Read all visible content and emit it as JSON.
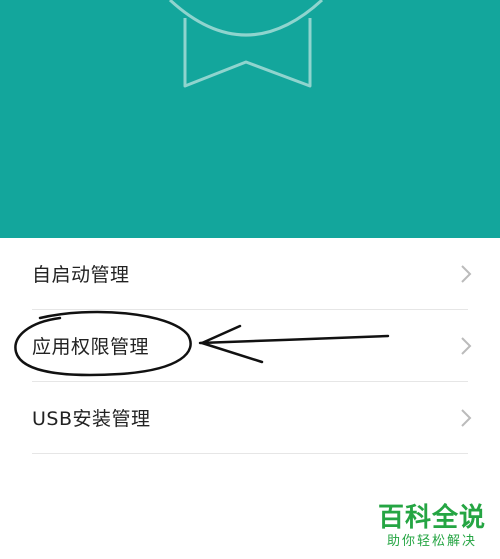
{
  "header": {
    "background_color": "#13a69c",
    "badge_icon": "ribbon-badge-icon"
  },
  "menu": {
    "items": [
      {
        "label": "自启动管理",
        "icon": "chevron-right-icon"
      },
      {
        "label": "应用权限管理",
        "icon": "chevron-right-icon"
      },
      {
        "label": "USB安装管理",
        "icon": "chevron-right-icon"
      }
    ]
  },
  "annotation": {
    "type": "hand-drawn-circle-and-arrow",
    "target_item": "应用权限管理",
    "color": "#111111"
  },
  "watermark": {
    "title": "百科全说",
    "subtitle": "助你轻松解决",
    "color": "#25a543"
  }
}
